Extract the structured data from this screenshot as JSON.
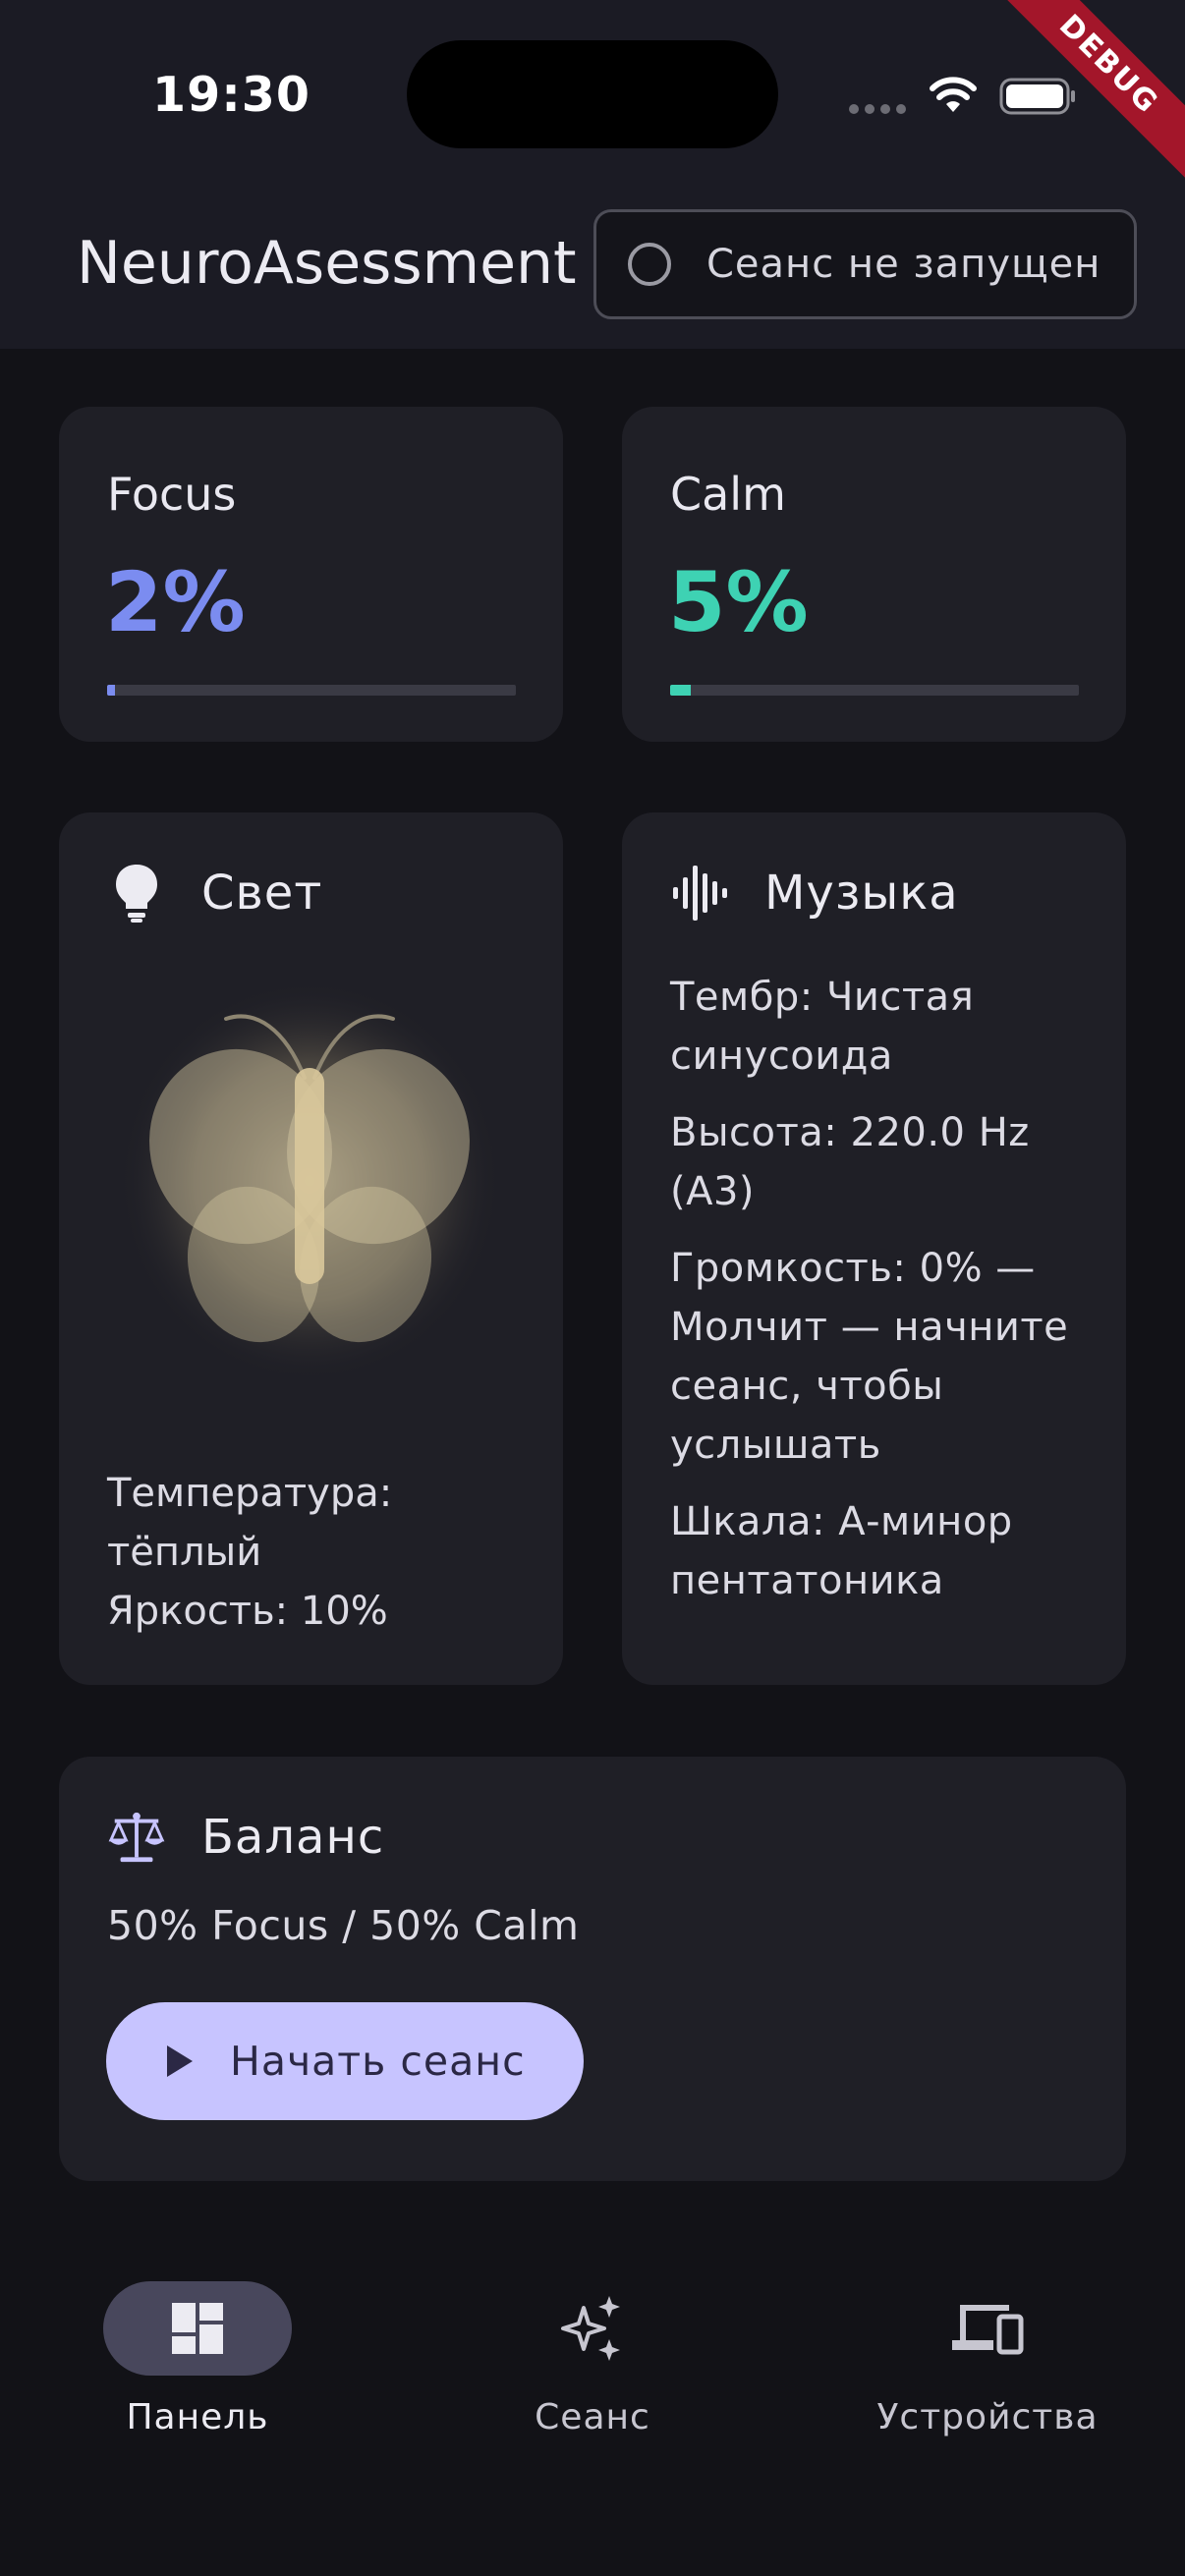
{
  "status_bar": {
    "time": "19:30",
    "debug_banner": "DEBUG"
  },
  "app_bar": {
    "title": "NeuroAsessment",
    "session_status": "Сеанс не запущен"
  },
  "metrics": [
    {
      "label": "Focus",
      "value": "2%",
      "level": 0.02,
      "color": "#7b8cf0"
    },
    {
      "label": "Calm",
      "value": "5%",
      "level": 0.05,
      "color": "#3ed2b3"
    }
  ],
  "light_card": {
    "title": "Свет",
    "icon": "lightbulb-icon",
    "temperature_line1": "Температура:",
    "temperature_line2": "тёплый",
    "brightness": "Яркость: 10%"
  },
  "music_card": {
    "title": "Музыка",
    "icon": "waveform-icon",
    "lines": [
      "Тембр: Чистая синусоида",
      "Высота: 220.0 Hz (A3)",
      "Громкость: 0% — Молчит — начните сеанс, чтобы услышать",
      "Шкала: А-минор пентатоника"
    ]
  },
  "balance_card": {
    "title": "Баланс",
    "icon": "scale-icon",
    "text": "50% Focus / 50% Calm",
    "button_label": "Начать сеанс"
  },
  "bottom_nav": {
    "items": [
      {
        "label": "Панель",
        "icon": "dashboard-icon",
        "active": true
      },
      {
        "label": "Сеанс",
        "icon": "sparkles-icon",
        "active": false
      },
      {
        "label": "Устройства",
        "icon": "devices-icon",
        "active": false
      }
    ]
  },
  "colors": {
    "background": "#121217",
    "card": "#1f1f26",
    "accent": "#c7c4ff",
    "focus": "#7b8cf0",
    "calm": "#3ed2b3"
  }
}
